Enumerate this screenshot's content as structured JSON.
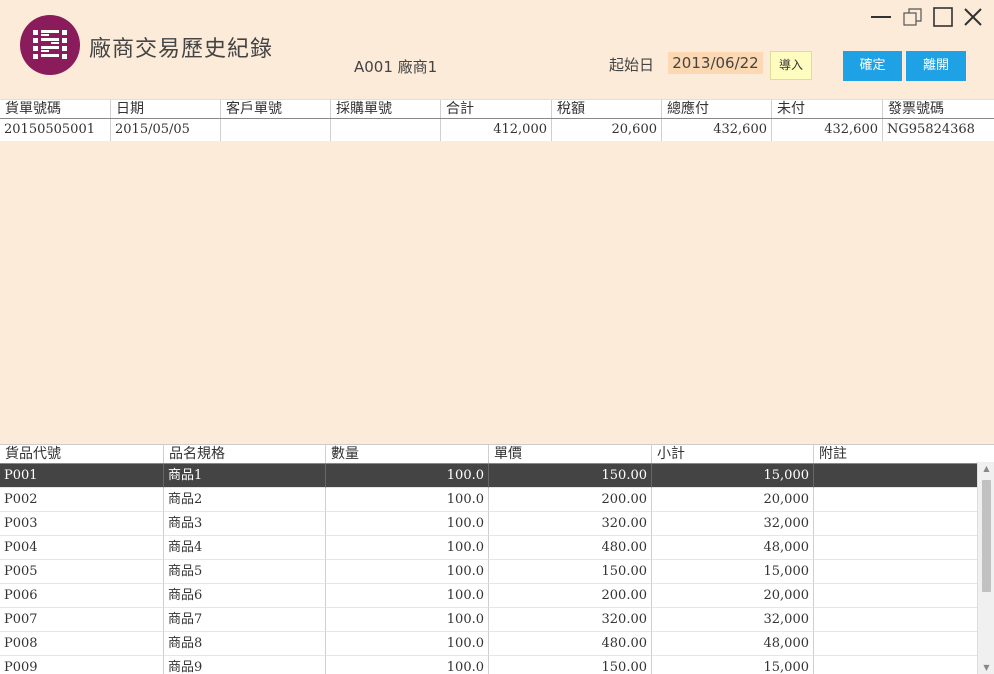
{
  "app": {
    "title": "廠商交易歷史紀錄",
    "vendor": "A001 廠商1",
    "start_label": "起始日",
    "start_date": "2013/06/22",
    "import_label": "導入",
    "ok_label": "確定",
    "exit_label": "離開",
    "icons": {
      "logo": "grid-logo-icon",
      "minimize": "minimize-icon",
      "restore": "restore-icon",
      "maximize": "maximize-icon",
      "close": "close-icon"
    },
    "colors": {
      "background": "#fdebd9",
      "brand": "#8a1c5c",
      "button": "#1ea2e5",
      "selected_row": "#444444"
    }
  },
  "invoices": {
    "columns": [
      "貨單號碼",
      "日期",
      "客戶單號",
      "採購單號",
      "合計",
      "稅額",
      "總應付",
      "未付",
      "發票號碼"
    ],
    "rows": [
      [
        "20150505001",
        "2015/05/05",
        "",
        "",
        "412,000",
        "20,600",
        "432,600",
        "432,600",
        "NG95824368"
      ]
    ]
  },
  "items": {
    "columns": [
      "貨品代號",
      "品名規格",
      "數量",
      "單價",
      "小計",
      "附註"
    ],
    "rows": [
      [
        "P001",
        "商品1",
        "100.0",
        "150.00",
        "15,000",
        ""
      ],
      [
        "P002",
        "商品2",
        "100.0",
        "200.00",
        "20,000",
        ""
      ],
      [
        "P003",
        "商品3",
        "100.0",
        "320.00",
        "32,000",
        ""
      ],
      [
        "P004",
        "商品4",
        "100.0",
        "480.00",
        "48,000",
        ""
      ],
      [
        "P005",
        "商品5",
        "100.0",
        "150.00",
        "15,000",
        ""
      ],
      [
        "P006",
        "商品6",
        "100.0",
        "200.00",
        "20,000",
        ""
      ],
      [
        "P007",
        "商品7",
        "100.0",
        "320.00",
        "32,000",
        ""
      ],
      [
        "P008",
        "商品8",
        "100.0",
        "480.00",
        "48,000",
        ""
      ],
      [
        "P009",
        "商品9",
        "100.0",
        "150.00",
        "15,000",
        ""
      ]
    ],
    "selected_index": 0
  }
}
